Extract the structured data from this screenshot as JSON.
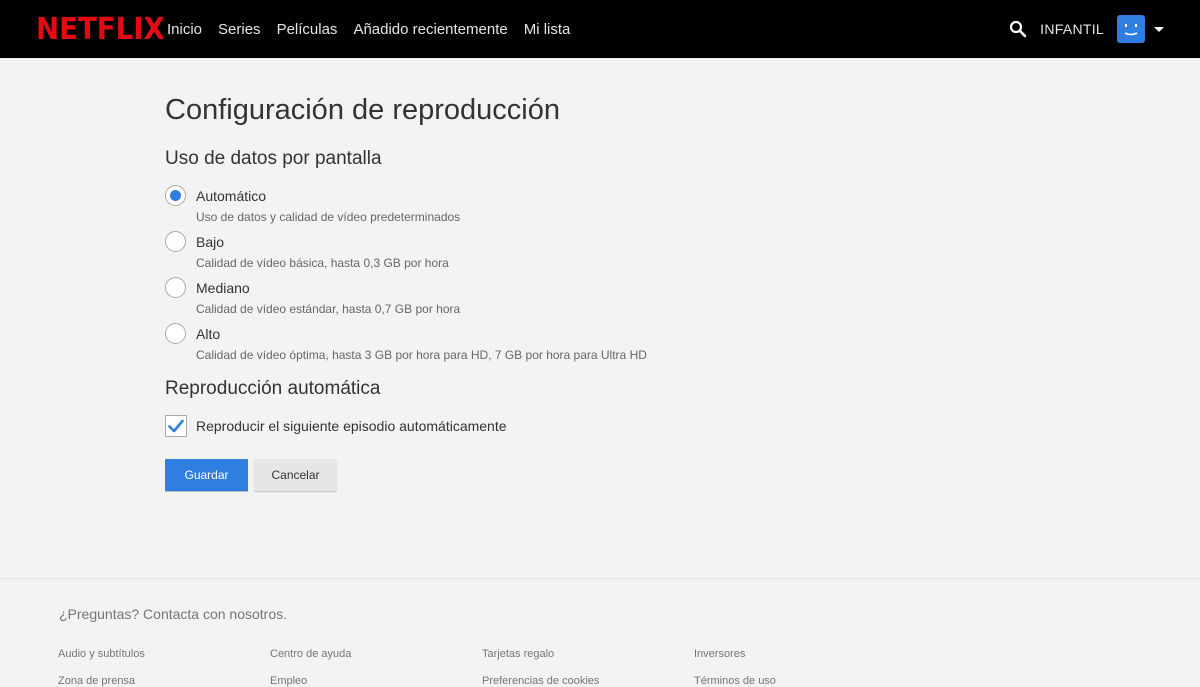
{
  "header": {
    "logo": "NETFLIX",
    "nav": [
      "Inicio",
      "Series",
      "Películas",
      "Añadido recientemente",
      "Mi lista"
    ],
    "profile_name": "INFANTIL",
    "icons": {
      "search": "search-icon",
      "caret": "caret-down-icon"
    },
    "colors": {
      "brand": "#e50914",
      "avatar": "#2f7fe0"
    }
  },
  "main": {
    "title": "Configuración de reproducción",
    "data_section_title": "Uso de datos por pantalla",
    "options": [
      {
        "label": "Automático",
        "description": "Uso de datos y calidad de vídeo predeterminados",
        "selected": true
      },
      {
        "label": "Bajo",
        "description": "Calidad de vídeo básica, hasta 0,3 GB por hora",
        "selected": false
      },
      {
        "label": "Mediano",
        "description": "Calidad de vídeo estándar, hasta 0,7 GB por hora",
        "selected": false
      },
      {
        "label": "Alto",
        "description": "Calidad de vídeo óptima, hasta 3 GB por hora para HD, 7 GB por hora para Ultra HD",
        "selected": false
      }
    ],
    "autoplay_section_title": "Reproducción automática",
    "autoplay_label": "Reproducir el siguiente episodio automáticamente",
    "autoplay_checked": true,
    "save_label": "Guardar",
    "cancel_label": "Cancelar"
  },
  "footer": {
    "contact": "¿Preguntas? Contacta con nosotros.",
    "links": [
      [
        "Audio y subtítulos",
        "Centro de ayuda",
        "Tarjetas regalo",
        "Inversores"
      ],
      [
        "Zona de prensa",
        "Empleo",
        "Preferencias de cookies",
        "Términos de uso"
      ]
    ]
  }
}
